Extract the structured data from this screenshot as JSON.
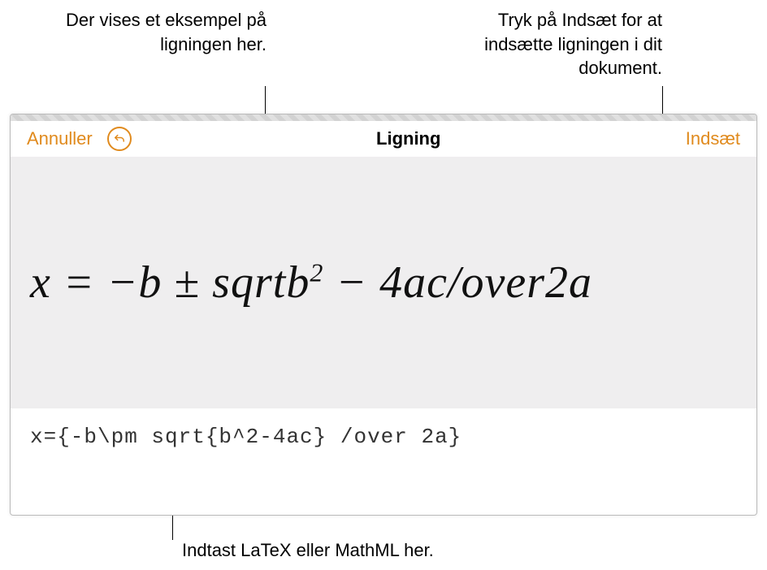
{
  "callouts": {
    "preview_hint": "Der vises et eksempel på ligningen her.",
    "insert_hint": "Tryk på Indsæt for at indsætte ligningen i dit dokument.",
    "input_hint": "Indtast LaTeX eller MathML her."
  },
  "topbar": {
    "cancel_label": "Annuller",
    "title": "Ligning",
    "insert_label": "Indsæt",
    "undo_icon": "undo-icon"
  },
  "equation": {
    "preview_text": "x = −b ± sqrtb² − 4ac/over2a",
    "preview_parts": {
      "p1": "x = −b ± sqrtb",
      "sup": "2",
      "p2": " − 4ac/over2a"
    },
    "input_value": "x={-b\\pm sqrt{b^2-4ac} /over 2a}"
  },
  "colors": {
    "accent": "#e08a1d",
    "preview_bg": "#efeeef"
  }
}
